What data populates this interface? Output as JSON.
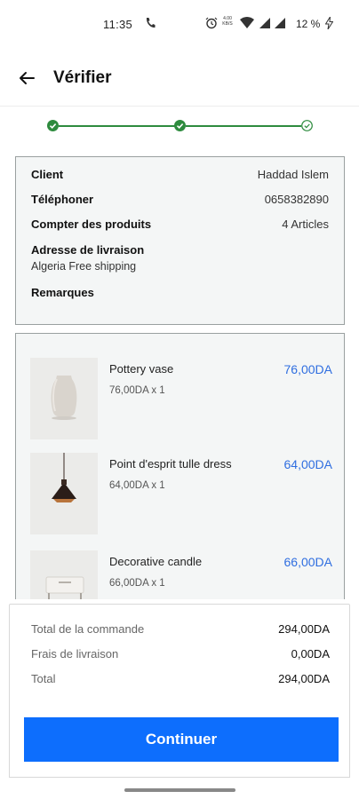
{
  "status_bar": {
    "time": "11:35",
    "net_speed_line1": "4.00",
    "net_speed_line2": "KB/S",
    "battery": "12 %",
    "icons": [
      "phone-icon",
      "alarm-icon",
      "wifi-icon",
      "signal-icon",
      "signal-icon",
      "charging-bolt-icon"
    ]
  },
  "app_bar": {
    "title": "Vérifier",
    "back_icon": "arrow-left-icon"
  },
  "stepper": {
    "steps_complete": 2,
    "steps_total": 3,
    "color": "#2e8b3e"
  },
  "info": {
    "client_label": "Client",
    "client_value": "Haddad Islem",
    "phone_label": "Téléphoner",
    "phone_value": "0658382890",
    "count_label": "Compter des produits",
    "count_value": "4 Articles",
    "address_label": "Adresse de livraison",
    "address_value": "Algeria Free shipping",
    "remarks_label": "Remarques"
  },
  "products": [
    {
      "name": "Pottery vase",
      "qty_line": "76,00DA   x 1",
      "price": "76,00DA"
    },
    {
      "name": "Point d'esprit tulle dress",
      "qty_line": "64,00DA   x 1",
      "price": "64,00DA"
    },
    {
      "name": "Decorative candle",
      "qty_line": "66,00DA   x 1",
      "price": "66,00DA"
    }
  ],
  "totals": {
    "order_label": "Total de la commande",
    "order_value": "294,00DA",
    "shipping_label": "Frais de livraison",
    "shipping_value": "0,00DA",
    "total_label": "Total",
    "total_value": "294,00DA"
  },
  "continue_label": "Continuer",
  "colors": {
    "accent": "#0d6efd",
    "price": "#2f6ee0",
    "step": "#2e8b3e"
  }
}
